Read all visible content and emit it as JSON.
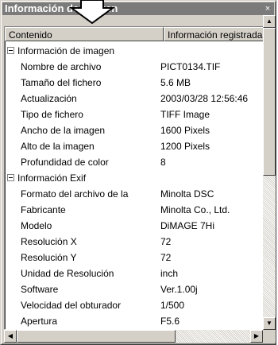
{
  "window": {
    "title": "Información de imagen",
    "close_glyph": "×"
  },
  "header": {
    "col1": "Contenido",
    "col2": "Información registrada"
  },
  "groups": [
    {
      "label": "Información de imagen",
      "rows": [
        {
          "name": "Nombre de archivo",
          "value": "PICT0134.TIF"
        },
        {
          "name": "Tamaño del fichero",
          "value": "5.6 MB"
        },
        {
          "name": "Actualización",
          "value": "2003/03/28 12:56:46"
        },
        {
          "name": "Tipo de fichero",
          "value": "TIFF Image"
        },
        {
          "name": "Ancho de la imagen",
          "value": "1600 Pixels"
        },
        {
          "name": "Alto de la imagen",
          "value": "1200 Pixels"
        },
        {
          "name": "Profundidad de color",
          "value": "8"
        }
      ]
    },
    {
      "label": "Información Exif",
      "rows": [
        {
          "name": "Formato del archivo de la",
          "value": "Minolta DSC"
        },
        {
          "name": "Fabricante",
          "value": "Minolta Co., Ltd."
        },
        {
          "name": "Modelo",
          "value": "DiMAGE 7Hi"
        },
        {
          "name": "Resolución X",
          "value": "72"
        },
        {
          "name": "Resolución Y",
          "value": "72"
        },
        {
          "name": "Unidad de Resolución",
          "value": "inch"
        },
        {
          "name": "Software",
          "value": "Ver.1.00j"
        },
        {
          "name": "Velocidad del obturador",
          "value": "1/500"
        },
        {
          "name": "Apertura",
          "value": "F5.6"
        }
      ]
    }
  ],
  "icons": {
    "scroll_up": "▲",
    "scroll_down": "▼",
    "scroll_left": "◀",
    "scroll_right": "▶"
  },
  "colors": {
    "titlebar": "#7b7b7b",
    "face": "#d4d0c8"
  }
}
